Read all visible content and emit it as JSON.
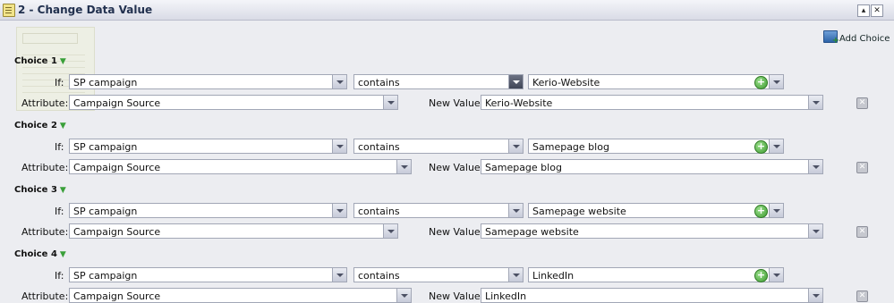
{
  "window": {
    "title": "2 - Change Data Value",
    "minimize_glyph": "▴",
    "close_glyph": "✕",
    "icon": "flow-icon"
  },
  "add_choice_label": "Add Choice",
  "labels": {
    "if": "If:",
    "attribute": "Attribute:",
    "new_value": "New Value:"
  },
  "choices": [
    {
      "label": "Choice 1",
      "if_field": "SP campaign",
      "operator": "contains",
      "match_value": "Kerio-Website",
      "attribute": "Campaign Source",
      "new_value": "Kerio-Website"
    },
    {
      "label": "Choice 2",
      "if_field": "SP campaign",
      "operator": "contains",
      "match_value": "Samepage blog",
      "attribute": "Campaign Source",
      "new_value": "Samepage blog"
    },
    {
      "label": "Choice 3",
      "if_field": "SP campaign",
      "operator": "contains",
      "match_value": "Samepage website",
      "attribute": "Campaign Source",
      "new_value": "Samepage website"
    },
    {
      "label": "Choice 4",
      "if_field": "SP campaign",
      "operator": "contains",
      "match_value": "LinkedIn",
      "attribute": "Campaign Source",
      "new_value": "LinkedIn"
    }
  ]
}
